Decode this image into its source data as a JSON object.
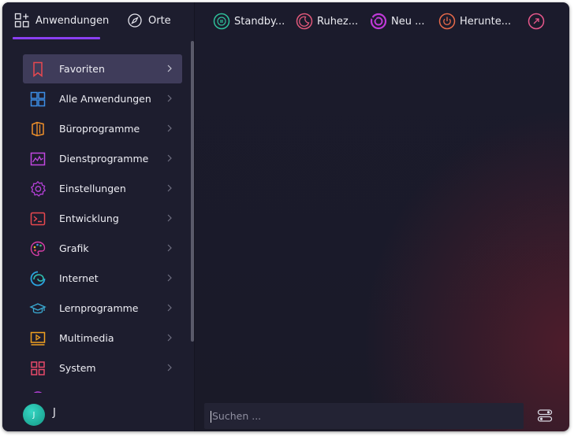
{
  "tabs": [
    {
      "label": "Anwendungen",
      "icon": "apps-grid-icon",
      "active": true
    },
    {
      "label": "Orte",
      "icon": "compass-icon",
      "active": false
    }
  ],
  "power_actions": [
    {
      "label": "Standby...",
      "icon": "standby-icon"
    },
    {
      "label": "Ruhez...",
      "icon": "hibernate-moon-icon"
    },
    {
      "label": "Neu ...",
      "icon": "restart-icon"
    },
    {
      "label": "Herunte...",
      "icon": "shutdown-icon"
    },
    {
      "label": "",
      "icon": "logout-icon"
    }
  ],
  "categories": [
    {
      "label": "Favoriten",
      "icon": "bookmark-icon",
      "active": true
    },
    {
      "label": "Alle Anwendungen",
      "icon": "all-apps-icon"
    },
    {
      "label": "Büroprogramme",
      "icon": "office-icon"
    },
    {
      "label": "Dienstprogramme",
      "icon": "utilities-icon"
    },
    {
      "label": "Einstellungen",
      "icon": "settings-gear-icon"
    },
    {
      "label": "Entwicklung",
      "icon": "terminal-icon"
    },
    {
      "label": "Grafik",
      "icon": "palette-icon"
    },
    {
      "label": "Internet",
      "icon": "internet-icon"
    },
    {
      "label": "Lernprogramme",
      "icon": "graduation-cap-icon"
    },
    {
      "label": "Multimedia",
      "icon": "multimedia-icon"
    },
    {
      "label": "System",
      "icon": "system-icon"
    },
    {
      "label": "",
      "icon": "globe-icon"
    }
  ],
  "user": {
    "initial": "J",
    "name": "J"
  },
  "search": {
    "placeholder": "Suchen ..."
  },
  "colors": {
    "accent": "#8a3ff2",
    "active_row": "#3f3c5a",
    "background": "#1b1b2c",
    "avatar": "#1fb8a4"
  }
}
